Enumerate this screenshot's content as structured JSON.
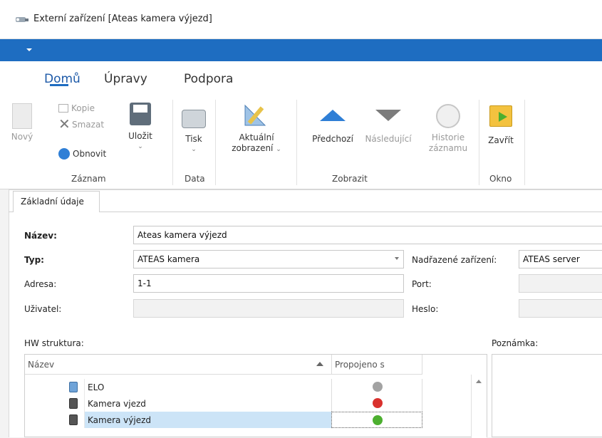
{
  "window": {
    "title": "Externí zařízení [Ateas kamera výjezd]"
  },
  "menu_tabs": [
    "Domů",
    "Úpravy",
    "Podpora"
  ],
  "ribbon": {
    "zaznam": {
      "label": "Záznam",
      "novy": "Nový",
      "kopie": "Kopie",
      "smazat": "Smazat",
      "obnovit": "Obnovit",
      "ulozit": "Uložit"
    },
    "data": {
      "label": "Data",
      "tisk": "Tisk"
    },
    "zobrazit": {
      "label": "Zobrazit",
      "aktualni_1": "Aktuální",
      "aktualni_2": "zobrazení",
      "predchozi": "Předchozí",
      "nasledujici": "Následující",
      "historie_1": "Historie",
      "historie_2": "záznamu"
    },
    "okno": {
      "label": "Okno",
      "zavrit": "Zavřít"
    }
  },
  "page_tab": "Základní údaje",
  "form": {
    "nazev_label": "Název:",
    "nazev_value": "Ateas kamera výjezd",
    "typ_label": "Typ:",
    "typ_value": "ATEAS kamera",
    "nadrazene_label": "Nadřazené zařízení:",
    "nadrazene_value": "ATEAS server",
    "adresa_label": "Adresa:",
    "adresa_value": "1-1",
    "port_label": "Port:",
    "port_value": "",
    "uzivatel_label": "Uživatel:",
    "uzivatel_value": "",
    "heslo_label": "Heslo:",
    "heslo_value": ""
  },
  "hw": {
    "label": "HW struktura:",
    "col_name": "Název",
    "col_linked": "Propojeno s",
    "rows": [
      {
        "name": "ELO",
        "status": "disconnected-gray"
      },
      {
        "name": "Kamera vjezd",
        "status": "error"
      },
      {
        "name": "Kamera výjezd",
        "status": "ok"
      }
    ]
  },
  "poznamka_label": "Poznámka:",
  "colors": {
    "accent": "#1e6dc1",
    "selected_row": "#cce4f7",
    "error": "#d9312d",
    "ok": "#4caf2f",
    "gray": "#a3a3a3"
  }
}
